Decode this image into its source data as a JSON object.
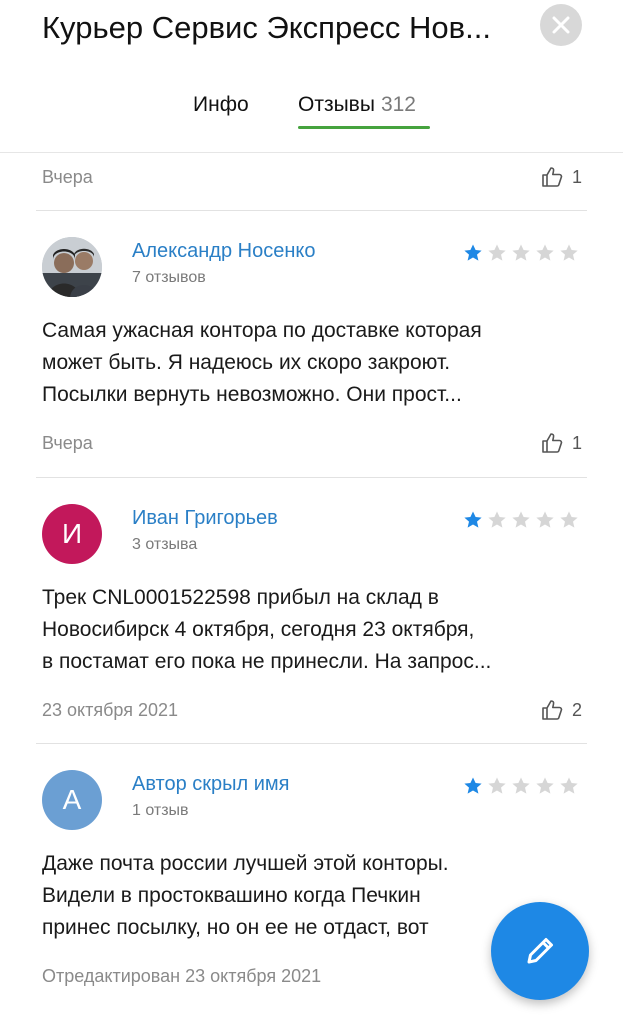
{
  "header": {
    "title": "Курьер Сервис Экспресс Нов...",
    "tabs": [
      {
        "label": "Инфо",
        "active": false
      },
      {
        "label": "Отзывы",
        "count": "312",
        "active": true
      }
    ]
  },
  "colors": {
    "accent": "#46a33e",
    "link": "#2a7fc6",
    "star": "#1e88e5",
    "fab": "#1e88e5"
  },
  "first_footer": {
    "date": "Вчера",
    "likes": "1"
  },
  "reviews": [
    {
      "author": "Александр Носенко",
      "count": "7 отзывов",
      "rating": 1,
      "avatar_type": "photo",
      "lines": [
        "Самая ужасная контора по доставке которая",
        "может быть. Я надеюсь их скоро закроют.",
        "Посылки вернуть невозможно. Они прост..."
      ],
      "date": "Вчера",
      "likes": "1"
    },
    {
      "author": "Иван Григорьев",
      "count": "3 отзыва",
      "rating": 1,
      "avatar_letter": "И",
      "avatar_color": "#c2185b",
      "lines": [
        "Трек CNL0001522598 прибыл на склад в",
        "Новосибирск 4 октября, сегодня 23 октября,",
        "в постамат его пока не принесли. На запрос..."
      ],
      "date": "23 октября 2021",
      "likes": "2"
    },
    {
      "author": "Автор скрыл имя",
      "count": "1 отзыв",
      "rating": 1,
      "avatar_letter": "А",
      "avatar_color": "#6b9fd3",
      "lines": [
        "Даже почта россии лучшей этой конторы.",
        "Видели в простоквашино когда Печкин",
        "принес посылку, но он ее не отдаст, вот"
      ],
      "date": "Отредактирован 23 октября 2021"
    }
  ],
  "fab": {
    "icon": "pencil-icon"
  }
}
